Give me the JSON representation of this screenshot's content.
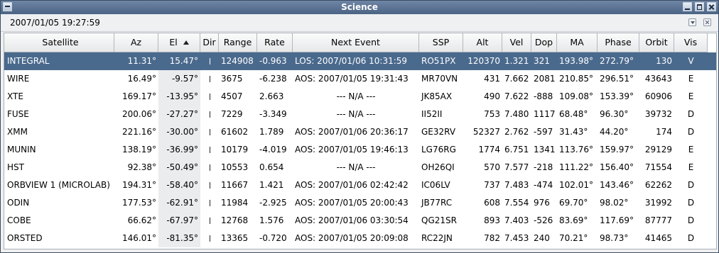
{
  "window": {
    "title": "Science"
  },
  "timestamp": "2007/01/05 19:27:59",
  "columns": [
    "Satellite",
    "Az",
    "El",
    "Dir",
    "Range",
    "Rate",
    "Next Event",
    "SSP",
    "Alt",
    "Vel",
    "Dop",
    "MA",
    "Phase",
    "Orbit",
    "Vis"
  ],
  "sorted_column": "El",
  "rows": [
    {
      "sat": "INTEGRAL",
      "az": "11.31°",
      "el": "15.47°",
      "range": "124908",
      "rate": "-0.963",
      "next": "LOS: 2007/01/06 10:31:59",
      "ssp": "RO51PX",
      "alt": "120370",
      "vel": "1.321",
      "dop": "321",
      "ma": "193.98°",
      "phase": "272.79°",
      "orbit": "130",
      "vis": "V"
    },
    {
      "sat": "WIRE",
      "az": "16.49°",
      "el": "-9.57°",
      "range": "3675",
      "rate": "-6.238",
      "next": "AOS: 2007/01/05 19:31:43",
      "ssp": "MR70VN",
      "alt": "431",
      "vel": "7.662",
      "dop": "2081",
      "ma": "210.85°",
      "phase": "296.51°",
      "orbit": "43643",
      "vis": "E"
    },
    {
      "sat": "XTE",
      "az": "169.17°",
      "el": "-13.95°",
      "range": "4507",
      "rate": "2.663",
      "next": "--- N/A ---",
      "ssp": "JK85AX",
      "alt": "490",
      "vel": "7.622",
      "dop": "-888",
      "ma": "109.08°",
      "phase": "153.39°",
      "orbit": "60906",
      "vis": "E"
    },
    {
      "sat": "FUSE",
      "az": "200.06°",
      "el": "-27.27°",
      "range": "7229",
      "rate": "-3.349",
      "next": "--- N/A ---",
      "ssp": "II52II",
      "alt": "753",
      "vel": "7.480",
      "dop": "1117",
      "ma": "68.48°",
      "phase": "96.30°",
      "orbit": "39732",
      "vis": "D"
    },
    {
      "sat": "XMM",
      "az": "221.16°",
      "el": "-30.00°",
      "range": "61602",
      "rate": "1.789",
      "next": "AOS: 2007/01/06 20:36:17",
      "ssp": "GE32RV",
      "alt": "52327",
      "vel": "2.762",
      "dop": "-597",
      "ma": "31.43°",
      "phase": "44.20°",
      "orbit": "174",
      "vis": "D"
    },
    {
      "sat": "MUNIN",
      "az": "138.19°",
      "el": "-36.99°",
      "range": "10179",
      "rate": "-4.019",
      "next": "AOS: 2007/01/05 19:46:13",
      "ssp": "LG76RG",
      "alt": "1774",
      "vel": "6.751",
      "dop": "1341",
      "ma": "113.76°",
      "phase": "159.97°",
      "orbit": "29129",
      "vis": "E"
    },
    {
      "sat": "HST",
      "az": "92.38°",
      "el": "-50.49°",
      "range": "10553",
      "rate": "0.654",
      "next": "--- N/A ---",
      "ssp": "OH26QI",
      "alt": "570",
      "vel": "7.577",
      "dop": "-218",
      "ma": "111.22°",
      "phase": "156.40°",
      "orbit": "71554",
      "vis": "E"
    },
    {
      "sat": "ORBVIEW 1 (MICROLAB)",
      "az": "194.31°",
      "el": "-58.40°",
      "range": "11667",
      "rate": "1.421",
      "next": "AOS: 2007/01/06 02:42:42",
      "ssp": "IC06LV",
      "alt": "737",
      "vel": "7.483",
      "dop": "-474",
      "ma": "102.01°",
      "phase": "143.46°",
      "orbit": "62262",
      "vis": "D"
    },
    {
      "sat": "ODIN",
      "az": "177.53°",
      "el": "-62.91°",
      "range": "11984",
      "rate": "-2.925",
      "next": "AOS: 2007/01/05 20:00:43",
      "ssp": "JB77RC",
      "alt": "608",
      "vel": "7.554",
      "dop": "976",
      "ma": "69.70°",
      "phase": "98.02°",
      "orbit": "31992",
      "vis": "D"
    },
    {
      "sat": "COBE",
      "az": "66.62°",
      "el": "-67.97°",
      "range": "12768",
      "rate": "1.576",
      "next": "AOS: 2007/01/06 03:30:54",
      "ssp": "QG21SR",
      "alt": "893",
      "vel": "7.403",
      "dop": "-526",
      "ma": "83.69°",
      "phase": "117.69°",
      "orbit": "87777",
      "vis": "D"
    },
    {
      "sat": "ORSTED",
      "az": "146.01°",
      "el": "-81.35°",
      "range": "13365",
      "rate": "-0.720",
      "next": "AOS: 2007/01/05 20:09:08",
      "ssp": "RC22JN",
      "alt": "782",
      "vel": "7.453",
      "dop": "240",
      "ma": "70.21°",
      "phase": "98.73°",
      "orbit": "41465",
      "vis": "D"
    }
  ]
}
